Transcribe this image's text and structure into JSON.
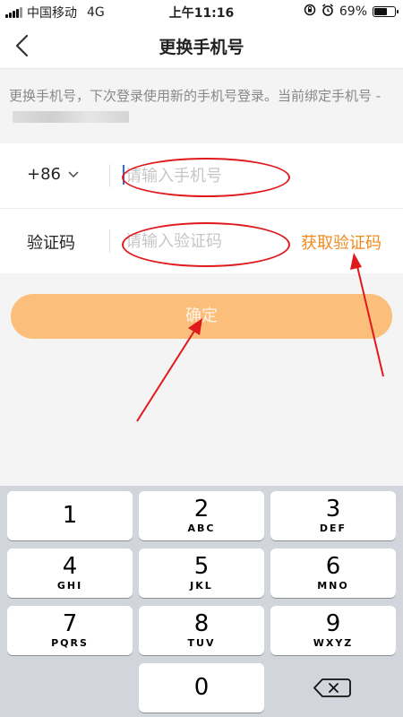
{
  "status_bar": {
    "carrier": "中国移动",
    "network": "4G",
    "time": "上午11:16",
    "battery_percent": "69%",
    "battery_level": 0.69
  },
  "nav": {
    "title": "更换手机号"
  },
  "description": {
    "text": "更换手机号，下次登录使用新的手机号登录。当前绑定手机号 -"
  },
  "form": {
    "country_code": "+86",
    "phone_placeholder": "请输入手机号",
    "code_label": "验证码",
    "code_placeholder": "请输入验证码",
    "get_code": "获取验证码"
  },
  "confirm_label": "确定",
  "keyboard": {
    "keys": [
      {
        "digit": "1",
        "letters": ""
      },
      {
        "digit": "2",
        "letters": "ABC"
      },
      {
        "digit": "3",
        "letters": "DEF"
      },
      {
        "digit": "4",
        "letters": "GHI"
      },
      {
        "digit": "5",
        "letters": "JKL"
      },
      {
        "digit": "6",
        "letters": "MNO"
      },
      {
        "digit": "7",
        "letters": "PQRS"
      },
      {
        "digit": "8",
        "letters": "TUV"
      },
      {
        "digit": "9",
        "letters": "WXYZ"
      },
      {
        "digit": "0",
        "letters": ""
      }
    ]
  },
  "colors": {
    "accent": "#f08a1c",
    "button": "#fbbe7b",
    "annotation": "#e0191c"
  }
}
